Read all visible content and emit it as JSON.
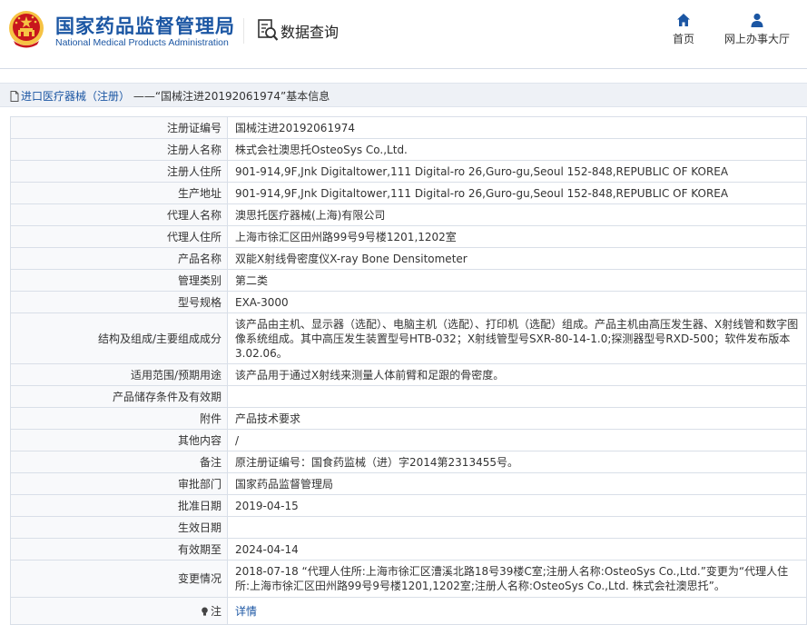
{
  "header": {
    "org_name_cn": "国家药品监督管理局",
    "org_name_en": "National Medical Products Administration",
    "section_title": "数据查询",
    "nav": [
      {
        "label": "首页",
        "icon": "home-icon"
      },
      {
        "label": "网上办事大厅",
        "icon": "user-icon"
      }
    ]
  },
  "breadcrumb": {
    "category": "进口医疗器械（注册）",
    "separator": "——",
    "current": "“国械注进20192061974”基本信息"
  },
  "colors": {
    "brand_blue": "#1b56a3",
    "emblem_red": "#c8161d",
    "emblem_gold": "#f6c344"
  },
  "fields": [
    {
      "label": "注册证编号",
      "value": "国械注进20192061974"
    },
    {
      "label": "注册人名称",
      "value": "株式会社澳思托OsteoSys Co.,Ltd."
    },
    {
      "label": "注册人住所",
      "value": "901-914,9F,Jnk Digitaltower,111 Digital-ro 26,Guro-gu,Seoul 152-848,REPUBLIC OF KOREA"
    },
    {
      "label": "生产地址",
      "value": "901-914,9F,Jnk Digitaltower,111 Digital-ro 26,Guro-gu,Seoul 152-848,REPUBLIC OF KOREA"
    },
    {
      "label": "代理人名称",
      "value": "澳思托医疗器械(上海)有限公司"
    },
    {
      "label": "代理人住所",
      "value": "上海市徐汇区田州路99号9号楼1201,1202室"
    },
    {
      "label": "产品名称",
      "value": "双能X射线骨密度仪X-ray Bone Densitometer"
    },
    {
      "label": "管理类别",
      "value": "第二类"
    },
    {
      "label": "型号规格",
      "value": "EXA-3000"
    },
    {
      "label": "结构及组成/主要组成成分",
      "value": "该产品由主机、显示器（选配）、电脑主机（选配）、打印机（选配）组成。产品主机由高压发生器、X射线管和数字图像系统组成。其中高压发生装置型号HTB-032；X射线管型号SXR-80-14-1.0;探测器型号RXD-500；软件发布版本3.02.06。"
    },
    {
      "label": "适用范围/预期用途",
      "value": "该产品用于通过X射线来测量人体前臂和足跟的骨密度。"
    },
    {
      "label": "产品储存条件及有效期",
      "value": ""
    },
    {
      "label": "附件",
      "value": "产品技术要求"
    },
    {
      "label": "其他内容",
      "value": "/"
    },
    {
      "label": "备注",
      "value": "原注册证编号：国食药监械（进）字2014第2313455号。"
    },
    {
      "label": "审批部门",
      "value": "国家药品监督管理局"
    },
    {
      "label": "批准日期",
      "value": "2019-04-15"
    },
    {
      "label": "生效日期",
      "value": ""
    },
    {
      "label": "有效期至",
      "value": "2024-04-14"
    },
    {
      "label": "变更情况",
      "value": "2018-07-18 “代理人住所:上海市徐汇区漕溪北路18号39楼C室;注册人名称:OsteoSys Co.,Ltd.”变更为“代理人住所:上海市徐汇区田州路99号9号楼1201,1202室;注册人名称:OsteoSys Co.,Ltd. 株式会社澳思托”。"
    }
  ],
  "note_row": {
    "label": "注",
    "icon": "lightbulb-icon",
    "link_text": "详情"
  }
}
